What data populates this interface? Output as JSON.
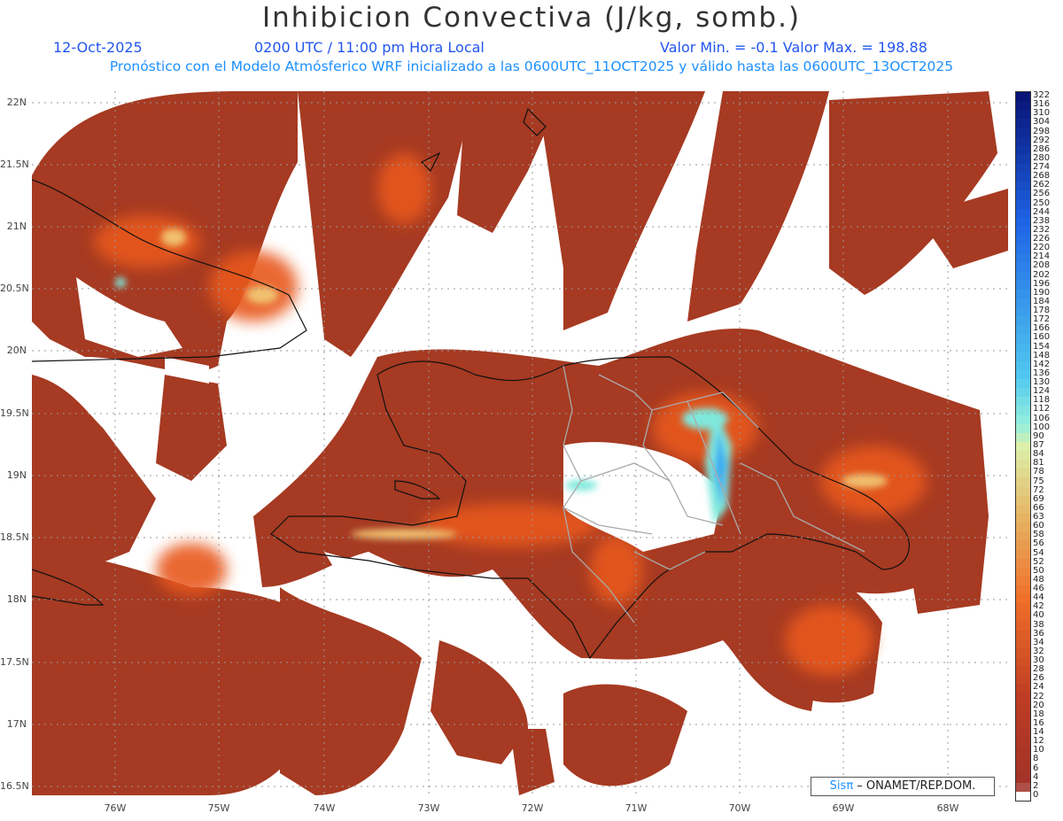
{
  "header": {
    "title": "Inhibicion Convectiva (J/kg, somb.)",
    "date": "12-Oct-2025",
    "time": "0200 UTC / 11:00 pm Hora Local",
    "min_max": "Valor Min. = -0.1  Valor Max. = 198.88",
    "subtitle": "Pronóstico con el Modelo Atmósferico WRF inicializado a las 0600UTC_11OCT2025 y válido hasta las  0600UTC_13OCT2025"
  },
  "map": {
    "lat_labels": [
      "22N",
      "21.5N",
      "21N",
      "20.5N",
      "20N",
      "19.5N",
      "19N",
      "18.5N",
      "18N",
      "17.5N",
      "17N",
      "16.5N"
    ],
    "lon_labels": [
      "76W",
      "75W",
      "74W",
      "73W",
      "72W",
      "71W",
      "70W",
      "69W",
      "68W"
    ],
    "colors": {
      "land_fill": "#a63a22",
      "orange": "#e8581f",
      "highlight": "#f0c070",
      "cyan": "#7fe8dc",
      "blue": "#3aaaf0",
      "coast": "#111111",
      "border": "#aaaaaa"
    }
  },
  "colorbar": {
    "labels": [
      "322",
      "316",
      "310",
      "304",
      "298",
      "292",
      "286",
      "280",
      "274",
      "268",
      "262",
      "256",
      "250",
      "244",
      "238",
      "232",
      "226",
      "220",
      "214",
      "208",
      "202",
      "196",
      "190",
      "184",
      "178",
      "172",
      "166",
      "160",
      "154",
      "148",
      "142",
      "136",
      "130",
      "124",
      "118",
      "112",
      "106",
      "100",
      "90",
      "87",
      "84",
      "81",
      "78",
      "75",
      "72",
      "69",
      "66",
      "63",
      "60",
      "58",
      "56",
      "54",
      "52",
      "50",
      "48",
      "46",
      "44",
      "42",
      "40",
      "38",
      "36",
      "34",
      "32",
      "30",
      "28",
      "26",
      "24",
      "22",
      "20",
      "18",
      "16",
      "14",
      "12",
      "10",
      "8",
      "6",
      "4",
      "2",
      "0"
    ]
  },
  "credit": {
    "brand": "Sis",
    "pi": "π",
    "text": "– ONAMET/REP.DOM."
  }
}
